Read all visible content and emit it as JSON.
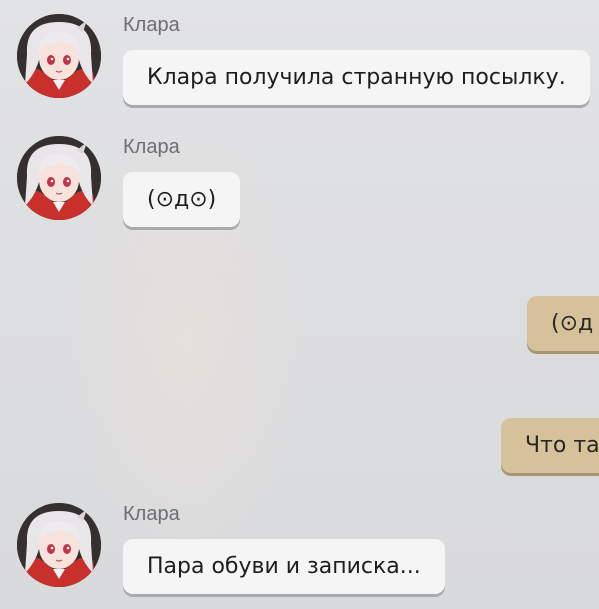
{
  "messages": [
    {
      "side": "left",
      "sender": "Клара",
      "text": "Клара получила странную посылку."
    },
    {
      "side": "left",
      "sender": "Клара",
      "text": "(⊙д⊙)"
    },
    {
      "side": "right",
      "text": "(⊙д"
    },
    {
      "side": "right",
      "text": "Что та"
    },
    {
      "side": "left",
      "sender": "Клара",
      "text": "Пара обуви и записка..."
    }
  ],
  "colors": {
    "left_bubble": "#f5f5f6",
    "right_bubble": "#d5c29a",
    "background": "#dcdddf",
    "sender_name": "#6d6e72"
  }
}
